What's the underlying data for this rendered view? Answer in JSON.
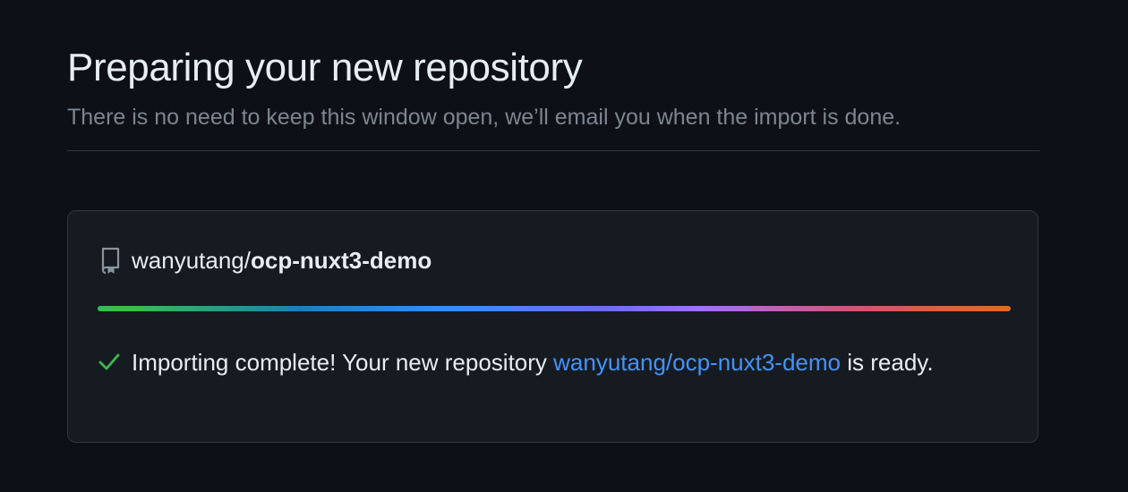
{
  "header": {
    "title": "Preparing your new repository",
    "subtitle": "There is no need to keep this window open, we’ll email you when the import is done."
  },
  "card": {
    "repo_icon": "repo-icon",
    "repo_owner": "wanyutang/",
    "repo_name": "ocp-nuxt3-demo",
    "progress": 1.0,
    "status_icon": "check-icon",
    "status_prefix": "Importing complete! Your new repository ",
    "status_link": "wanyutang/ocp-nuxt3-demo",
    "status_suffix": " is ready."
  },
  "colors": {
    "background": "#0d1117",
    "card_background": "#161b22",
    "border": "#30363d",
    "link": "#4493f8",
    "success": "#3fb950",
    "muted": "#7d8590"
  }
}
